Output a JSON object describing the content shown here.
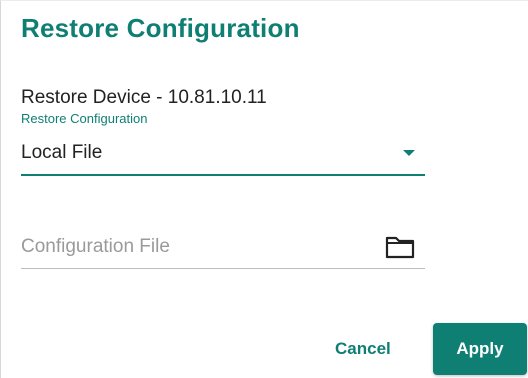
{
  "dialog": {
    "title": "Restore Configuration",
    "subtitle": "Restore Device - 10.81.10.11"
  },
  "source_select": {
    "label": "Restore Configuration",
    "value": "Local File"
  },
  "file_field": {
    "placeholder": "Configuration File",
    "value": "",
    "icon": "folder-icon"
  },
  "actions": {
    "cancel_label": "Cancel",
    "apply_label": "Apply"
  },
  "colors": {
    "accent": "#0f7f74",
    "text": "#222222",
    "placeholder": "#9a9a9a"
  }
}
